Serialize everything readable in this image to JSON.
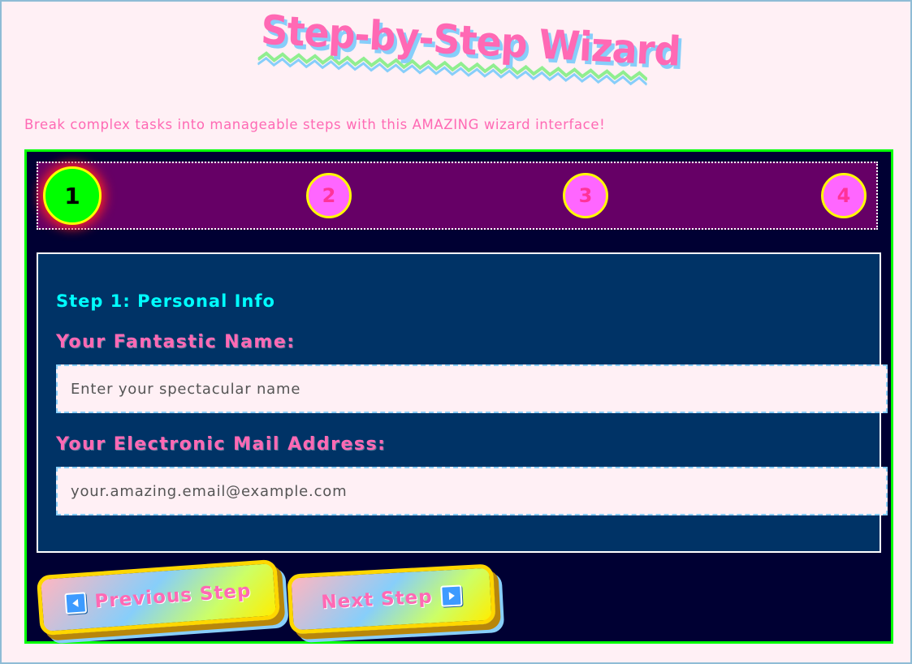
{
  "header": {
    "title": "Step-by-Step Wizard",
    "subtitle": "Break complex tasks into manageable steps with this AMAZING wizard interface!"
  },
  "progress": {
    "steps": [
      {
        "number": "1",
        "active": true
      },
      {
        "number": "2",
        "active": false
      },
      {
        "number": "3",
        "active": false
      },
      {
        "number": "4",
        "active": false
      }
    ]
  },
  "panel": {
    "step_title": "Step 1: Personal Info",
    "name_label": "Your Fantastic Name:",
    "name_placeholder": "Enter your spectacular name",
    "email_label": "Your Electronic Mail Address:",
    "email_placeholder": "your.amazing.email@example.com"
  },
  "buttons": {
    "prev_label": "Previous Step",
    "next_label": "Next Step"
  },
  "colors": {
    "page_bg": "#fff0f5",
    "accent_pink": "#ff69b4",
    "wizard_border": "#00ff00",
    "progress_bg": "#660066",
    "panel_bg": "#003366",
    "step_title": "#00ffff",
    "active_step": "#00ff00",
    "inactive_step": "#ff66ff"
  },
  "icons": {
    "prev": "left-arrow-icon",
    "next": "right-arrow-icon"
  }
}
